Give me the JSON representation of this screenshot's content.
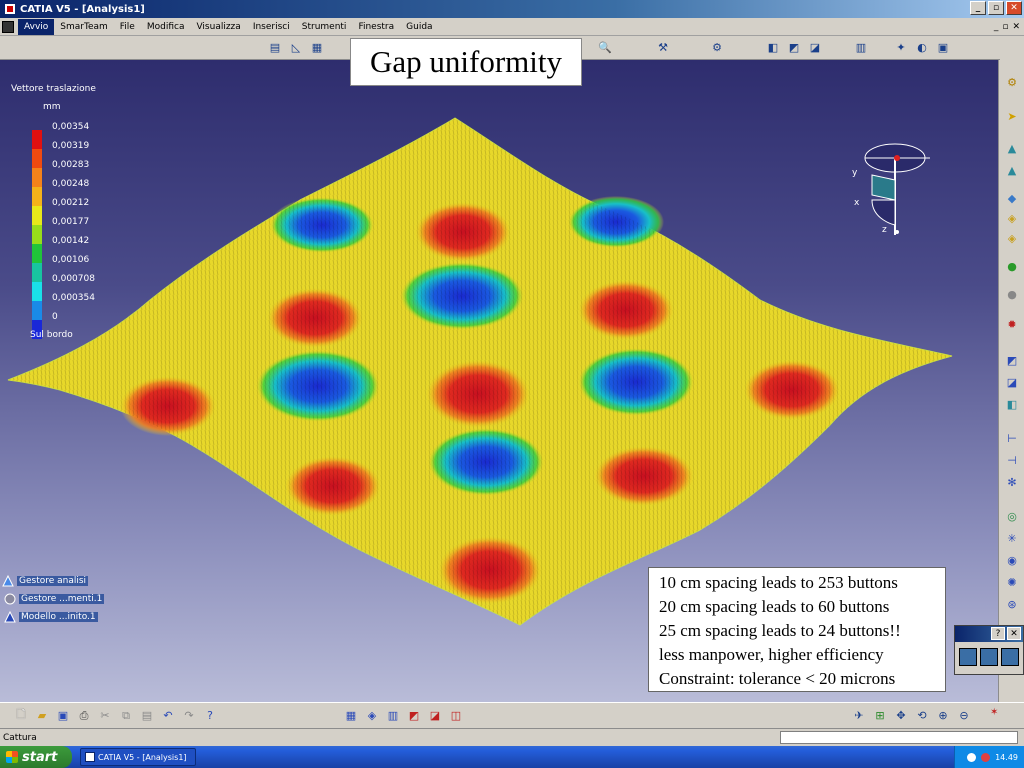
{
  "window": {
    "title": "CATIA V5 - [Analysis1]",
    "controls": [
      "_",
      "▫",
      "✕"
    ]
  },
  "menu": {
    "items": [
      "Avvio",
      "SmarTeam",
      "File",
      "Modifica",
      "Visualizza",
      "Inserisci",
      "Strumenti",
      "Finestra",
      "Guida"
    ],
    "mdi_controls": [
      "_",
      "▫",
      "✕"
    ]
  },
  "slide": {
    "title": "Gap uniformity",
    "notes": [
      "10 cm spacing leads to  253 buttons",
      "20 cm spacing leads to 60 buttons",
      "25 cm spacing leads to 24 buttons!!",
      "less manpower, higher efficiency",
      "Constraint: tolerance < 20 microns"
    ]
  },
  "legend": {
    "title": "Vettore traslazione",
    "unit": "mm",
    "values": [
      "0,00354",
      "0,00319",
      "0,00283",
      "0,00248",
      "0,00212",
      "0,00177",
      "0,00142",
      "0,00106",
      "0,000708",
      "0,000354",
      "0"
    ],
    "colors": [
      "#e01010",
      "#f04a10",
      "#f5821a",
      "#f4b21a",
      "#e8e81a",
      "#98dc1a",
      "#20c43a",
      "#18c4a0",
      "#1ae0e8",
      "#1a8ae8",
      "#1a28d8"
    ],
    "footer": "Sul bordo"
  },
  "compass": {
    "labels": [
      "y",
      "x",
      "z"
    ]
  },
  "tree": {
    "items": [
      {
        "label": "Gestore analisi"
      },
      {
        "label": "Gestore ...menti.1"
      },
      {
        "label": "Modello ...inito.1"
      }
    ]
  },
  "status": {
    "text": "Cattura"
  },
  "taskbar": {
    "start_label": "start",
    "task_label": "CATIA V5 - [Analysis1]",
    "clock": "14.49"
  },
  "mini_dialog": {
    "buttons": [
      "?",
      "✕"
    ]
  }
}
